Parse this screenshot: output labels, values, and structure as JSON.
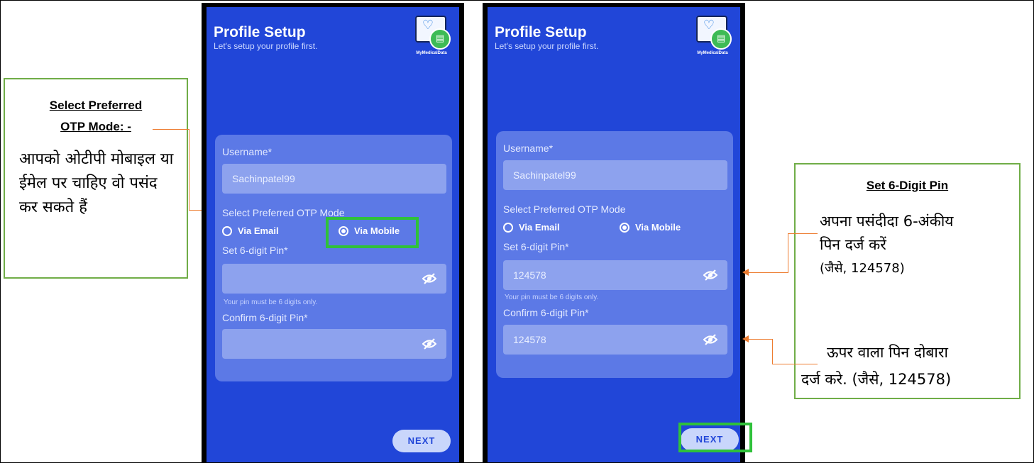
{
  "screens": [
    {
      "title": "Profile Setup",
      "subtitle": "Let's setup your profile first.",
      "logo_text": "MyMedicalData",
      "username_label": "Username*",
      "username_value": "Sachinpatel99",
      "otp_mode_label": "Select Preferred OTP Mode",
      "radio_email": "Via Email",
      "radio_mobile": "Via Mobile",
      "pin_label": "Set 6-digit Pin*",
      "pin_value": "",
      "pin_hint": "Your pin must be 6 digits only.",
      "confirm_label": "Confirm 6-digit Pin*",
      "confirm_value": "",
      "next_label": "NEXT"
    },
    {
      "title": "Profile Setup",
      "subtitle": "Let's setup your profile first.",
      "logo_text": "MyMedicalData",
      "username_label": "Username*",
      "username_value": "Sachinpatel99",
      "otp_mode_label": "Select Preferred OTP Mode",
      "radio_email": "Via Email",
      "radio_mobile": "Via Mobile",
      "pin_label": "Set 6-digit Pin*",
      "pin_value": "124578",
      "pin_hint": "Your pin must be 6 digits only.",
      "confirm_label": "Confirm 6-digit Pin*",
      "confirm_value": "124578",
      "next_label": "NEXT"
    }
  ],
  "callouts": {
    "otp_mode": {
      "heading_line1": "Select Preferred",
      "heading_line2": "OTP Mode: -",
      "body": "आपको ओटीपी मोबाइल या ईमेल पर चाहिए वो पसंद कर सकते हैं"
    },
    "pin": {
      "heading": "Set 6-Digit Pin",
      "set_text_line1": "अपना पसंदीदा 6-अंकीय",
      "set_text_line2": "पिन दर्ज करें",
      "set_text_line3": "(जैसे, 124578)",
      "confirm_text_line1": "ऊपर वाला पिन दोबारा",
      "confirm_text_line2": "दर्ज करे. (जैसे, 124578)"
    }
  },
  "colors": {
    "screen_bg": "#2146d8",
    "highlight": "#2fc13a",
    "callout_border": "#70ad47",
    "connector": "#ed7d31"
  },
  "icons": [
    "eye-off-icon",
    "radio-selected-icon",
    "radio-unselected-icon",
    "medical-folder-logo"
  ]
}
